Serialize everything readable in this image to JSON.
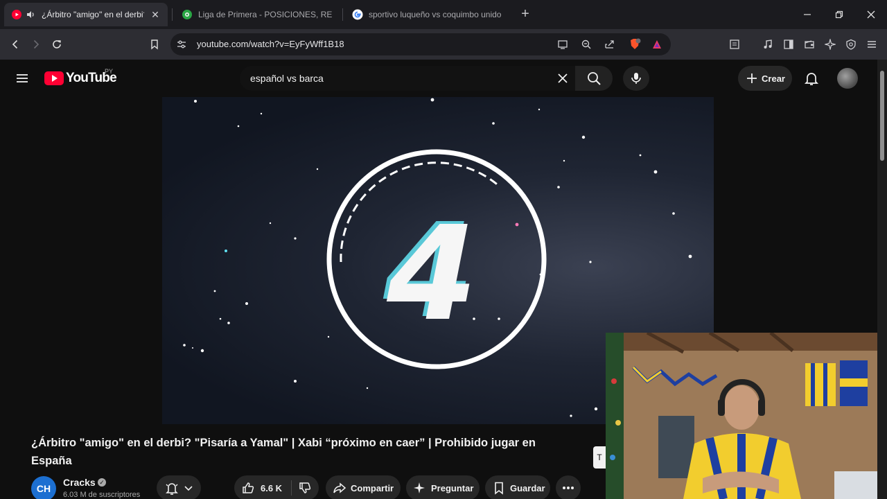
{
  "browser": {
    "tabs": [
      {
        "title": "¿Árbitro \"amigo\" en el derbi?",
        "icon": "youtube-icon",
        "muted_icon": "speaker-icon",
        "active": true
      },
      {
        "title": "Liga de Primera - POSICIONES, RESU",
        "icon": "soccer-ball-icon",
        "active": false
      },
      {
        "title": "sportivo luqueño vs coquimbo unido",
        "icon": "google-icon",
        "active": false
      }
    ],
    "address": "youtube.com/watch?v=EyFyWff1B18"
  },
  "youtube": {
    "logo_text": "YouTube",
    "country_code": "PY",
    "search_value": "español vs barca",
    "create_label": "Crear",
    "video": {
      "countdown_number": "4",
      "title": "¿Árbitro \"amigo\" en el derbi? \"Pisaría a Yamal\" | Xabi “próximo en caer” | Prohibido jugar en España",
      "channel_avatar_text": "CH",
      "channel_name": "Cracks",
      "subscribers": "6.03 M de suscriptores",
      "likes": "6.6 K",
      "share_label": "Compartir",
      "ask_label": "Preguntar",
      "save_label": "Guardar"
    }
  },
  "colors": {
    "youtube_red": "#ff0033",
    "page_bg": "#0f0f0f",
    "pill_bg": "#272727",
    "browser_tab_bg": "#1b1b1f",
    "browser_toolbar_bg": "#2d2d33"
  }
}
